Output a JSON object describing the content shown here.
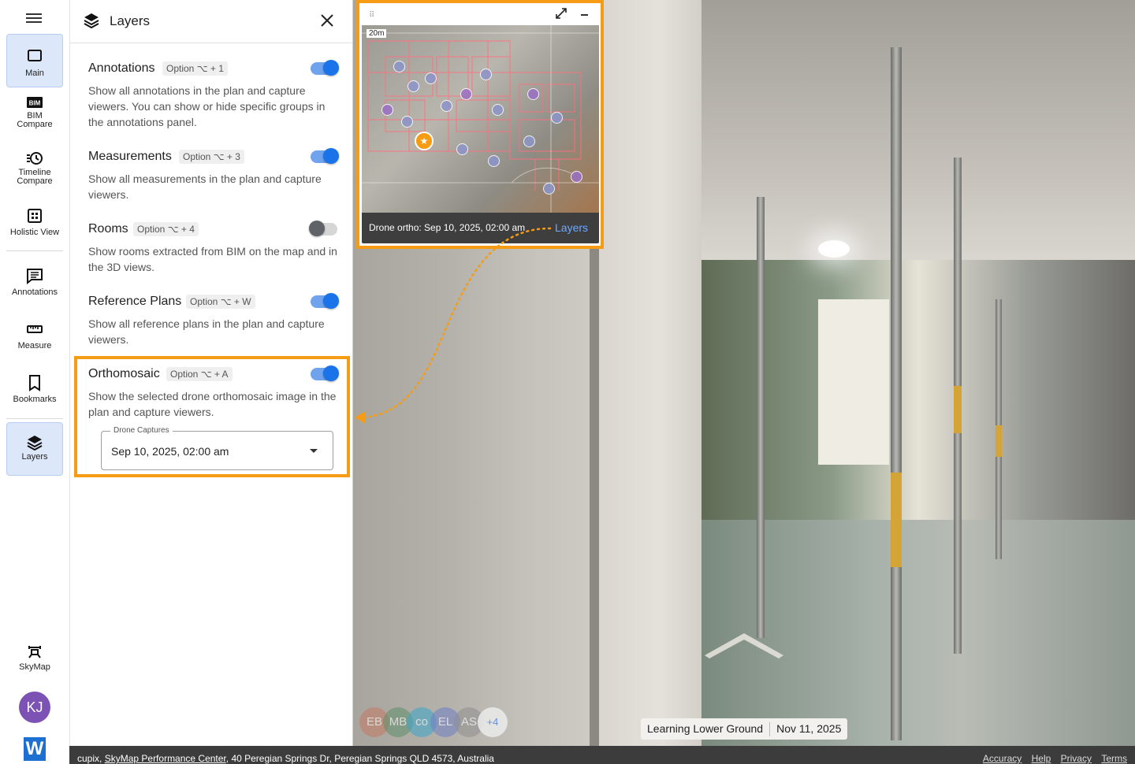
{
  "nav": {
    "items": [
      {
        "label": "Main",
        "icon": "monitor-icon"
      },
      {
        "label": "BIM\nCompare",
        "icon": "bim-icon"
      },
      {
        "label": "Timeline\nCompare",
        "icon": "timeline-icon"
      },
      {
        "label": "Holistic View",
        "icon": "grid-icon"
      },
      {
        "label": "Annotations",
        "icon": "annotation-icon"
      },
      {
        "label": "Measure",
        "icon": "ruler-icon"
      },
      {
        "label": "Bookmarks",
        "icon": "bookmark-icon"
      },
      {
        "label": "Layers",
        "icon": "layers-icon"
      }
    ],
    "skymap": "SkyMap",
    "user_initials": "KJ",
    "logo_letter": "W",
    "active_color": "#dde7fa"
  },
  "panel": {
    "title": "Layers",
    "layers": [
      {
        "name": "Annotations",
        "shortcut": "Option ⌥ + 1",
        "on": true,
        "desc": "Show all annotations in the plan and capture viewers. You can show or hide specific groups in the annotations panel."
      },
      {
        "name": "Measurements",
        "shortcut": "Option ⌥ + 3",
        "on": true,
        "desc": "Show all measurements in the plan and capture viewers."
      },
      {
        "name": "Rooms",
        "shortcut": "Option ⌥ + 4",
        "on": false,
        "desc": "Show rooms extracted from BIM on the map and in the 3D views."
      },
      {
        "name": "Reference Plans",
        "shortcut": "Option ⌥ + W",
        "on": true,
        "desc": "Show all reference plans in the plan and capture viewers."
      },
      {
        "name": "Orthomosaic",
        "shortcut": "Option ⌥ + A",
        "on": true,
        "desc": "Show the selected drone orthomosaic image in the plan and capture viewers."
      }
    ],
    "drone_select": {
      "legend": "Drone Captures",
      "value": "Sep 10, 2025, 02:00 am"
    },
    "highlight_color": "#f59b14",
    "toggle_color": "#1a73e8"
  },
  "minimap": {
    "scale": "20m",
    "caption": "Drone ortho: Sep 10, 2025, 02:00 am",
    "layers_link": "Layers"
  },
  "viewer": {
    "participants": [
      "EB",
      "MB",
      "co",
      "EL",
      "AS"
    ],
    "participant_colors": [
      "#c47a62",
      "#5f8f6b",
      "#3aa6c9",
      "#6f7fc4",
      "#8f8f8f"
    ],
    "more": "+4",
    "level": "Learning Lower Ground",
    "date": "Nov 11, 2025"
  },
  "footer": {
    "org": "cupix,",
    "site": "SkyMap Performance Center",
    "address": ", 40 Peregian Springs Dr, Peregian Springs QLD 4573, Australia",
    "links": [
      "Accuracy",
      "Help",
      "Privacy",
      "Terms"
    ]
  }
}
